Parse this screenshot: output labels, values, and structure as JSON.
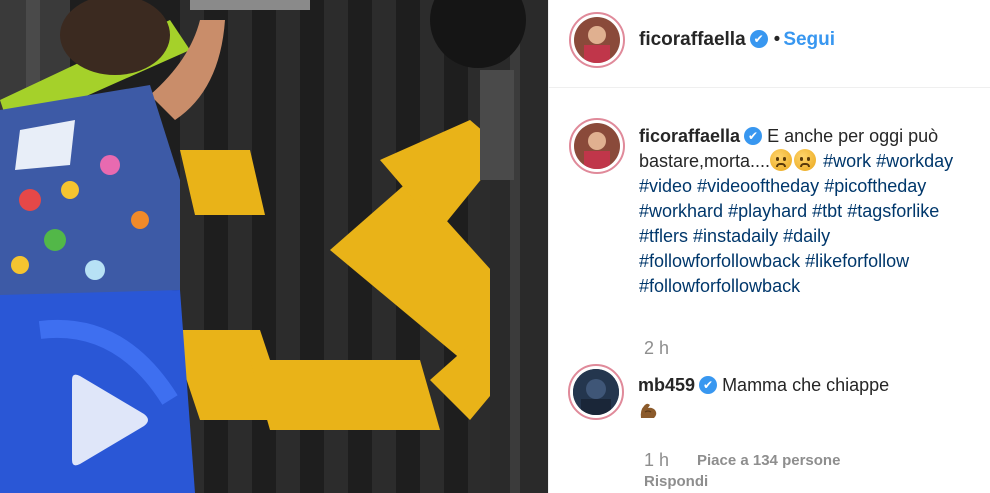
{
  "post": {
    "username": "ficoraffaella",
    "verified_badge": "✔",
    "separator": "•",
    "follow_label": "Segui"
  },
  "caption": {
    "username": "ficoraffaella",
    "text": "E anche per oggi può bastare,morta....",
    "hashtags": [
      "#work",
      "#workday",
      "#video",
      "#videooftheday",
      "#picoftheday",
      "#workhard",
      "#playhard",
      "#tbt",
      "#tagsforlike",
      "#tflers",
      "#instadaily",
      "#daily",
      "#followforfollowback",
      "#likeforfollow",
      "#followforfollowback"
    ],
    "time": "2 h"
  },
  "comment": {
    "username": "mb459",
    "text": "Mamma che chiappe",
    "time": "1 h",
    "likes_label": "Piace a 134 persone",
    "reply_label": "Rispondi"
  },
  "colors": {
    "link": "#00376b",
    "follow": "#3897f0",
    "muted": "#8e8e8e",
    "story_ring": "#e08a9a"
  },
  "icons": {
    "verified": "verified-badge-icon",
    "play": "play-icon",
    "emoji": "sad-face-emoji-icon",
    "flex": "flexed-biceps-emoji-icon"
  }
}
